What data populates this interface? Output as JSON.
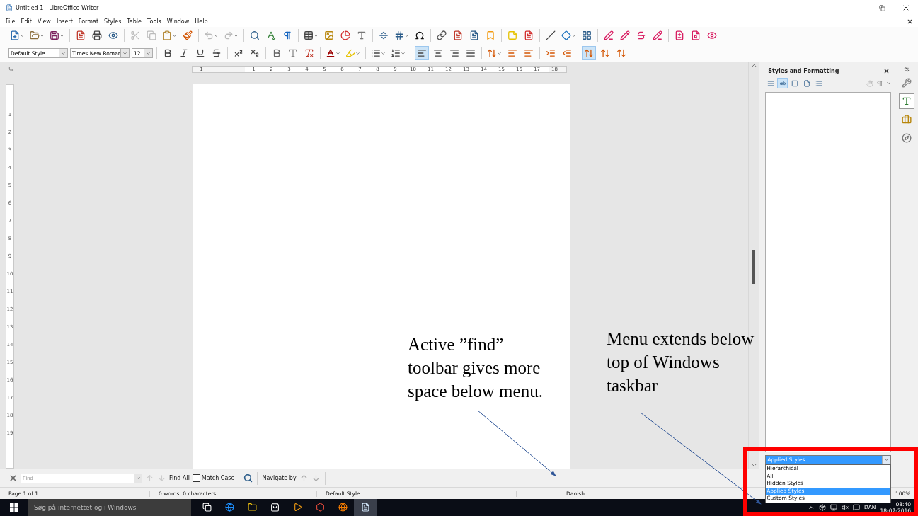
{
  "window": {
    "title": "Untitled 1 - LibreOffice Writer"
  },
  "menu": [
    "File",
    "Edit",
    "View",
    "Insert",
    "Format",
    "Styles",
    "Table",
    "Tools",
    "Window",
    "Help"
  ],
  "formatting_toolbar": {
    "paragraph_style": "Default Style",
    "font_name": "Times New Roman",
    "font_size": "12",
    "buttons": [
      {
        "selected": false
      },
      {
        "selected": false
      },
      {
        "selected": false
      },
      {
        "selected": false
      },
      {
        "selected": false
      },
      {
        "selected": false
      },
      {
        "selected": false
      },
      {
        "selected": false
      },
      {
        "selected": false
      },
      {
        "selected": false
      },
      {
        "selected": false
      },
      {
        "selected": false
      },
      {
        "selected": false
      },
      {
        "selected": true
      },
      {
        "selected": false
      },
      {
        "selected": false
      },
      {
        "selected": false
      },
      {
        "selected": false
      },
      {
        "selected": false
      },
      {
        "selected": false
      },
      {
        "selected": false
      },
      {
        "selected": false
      },
      {
        "selected": true
      },
      {
        "selected": false
      },
      {
        "selected": false
      }
    ]
  },
  "ruler": {
    "left_label": "1",
    "marks": [
      "1",
      "2",
      "3",
      "4",
      "5",
      "6",
      "7",
      "8",
      "9",
      "10",
      "11",
      "12",
      "13",
      "14",
      "15",
      "16",
      "17",
      "18"
    ],
    "vertical_marks": [
      "1",
      "2",
      "3",
      "4",
      "5",
      "6",
      "7",
      "8",
      "9",
      "10",
      "11",
      "12",
      "13",
      "14",
      "15",
      "16",
      "17",
      "18",
      "19"
    ]
  },
  "sidebar": {
    "title": "Styles and Formatting",
    "deck_buttons": [
      {
        "selected": false
      },
      {
        "selected": true
      },
      {
        "selected": false
      },
      {
        "selected": false
      },
      {
        "selected": false
      }
    ],
    "tabs": [
      {
        "selected": false
      },
      {
        "selected": true
      },
      {
        "selected": false
      },
      {
        "selected": false
      }
    ],
    "filter": {
      "value": "Applied Styles",
      "options": [
        {
          "label": "Hierarchical",
          "selected": false
        },
        {
          "label": "All",
          "selected": false
        },
        {
          "label": "Hidden Styles",
          "selected": false
        },
        {
          "label": "Applied Styles",
          "selected": true
        },
        {
          "label": "Custom Styles",
          "selected": false
        }
      ]
    }
  },
  "find_toolbar": {
    "placeholder": "Find",
    "find_all": "Find All",
    "match_case": {
      "label": "Match Case",
      "checked": false
    },
    "navigate_by": "Navigate by"
  },
  "status_bar": {
    "page": "Page 1 of 1",
    "words": "0 words, 0 characters",
    "style": "Default Style",
    "language": "Danish",
    "zoom": "100%"
  },
  "taskbar": {
    "search_placeholder": "Søg på internettet og i Windows",
    "language": "DAN",
    "time": "08:40",
    "date": "18-07-2016"
  },
  "annotations": [
    {
      "text": "Active ”find” toolbar gives more space below menu."
    },
    {
      "text": "Menu extends below top of Windows taskbar"
    }
  ]
}
